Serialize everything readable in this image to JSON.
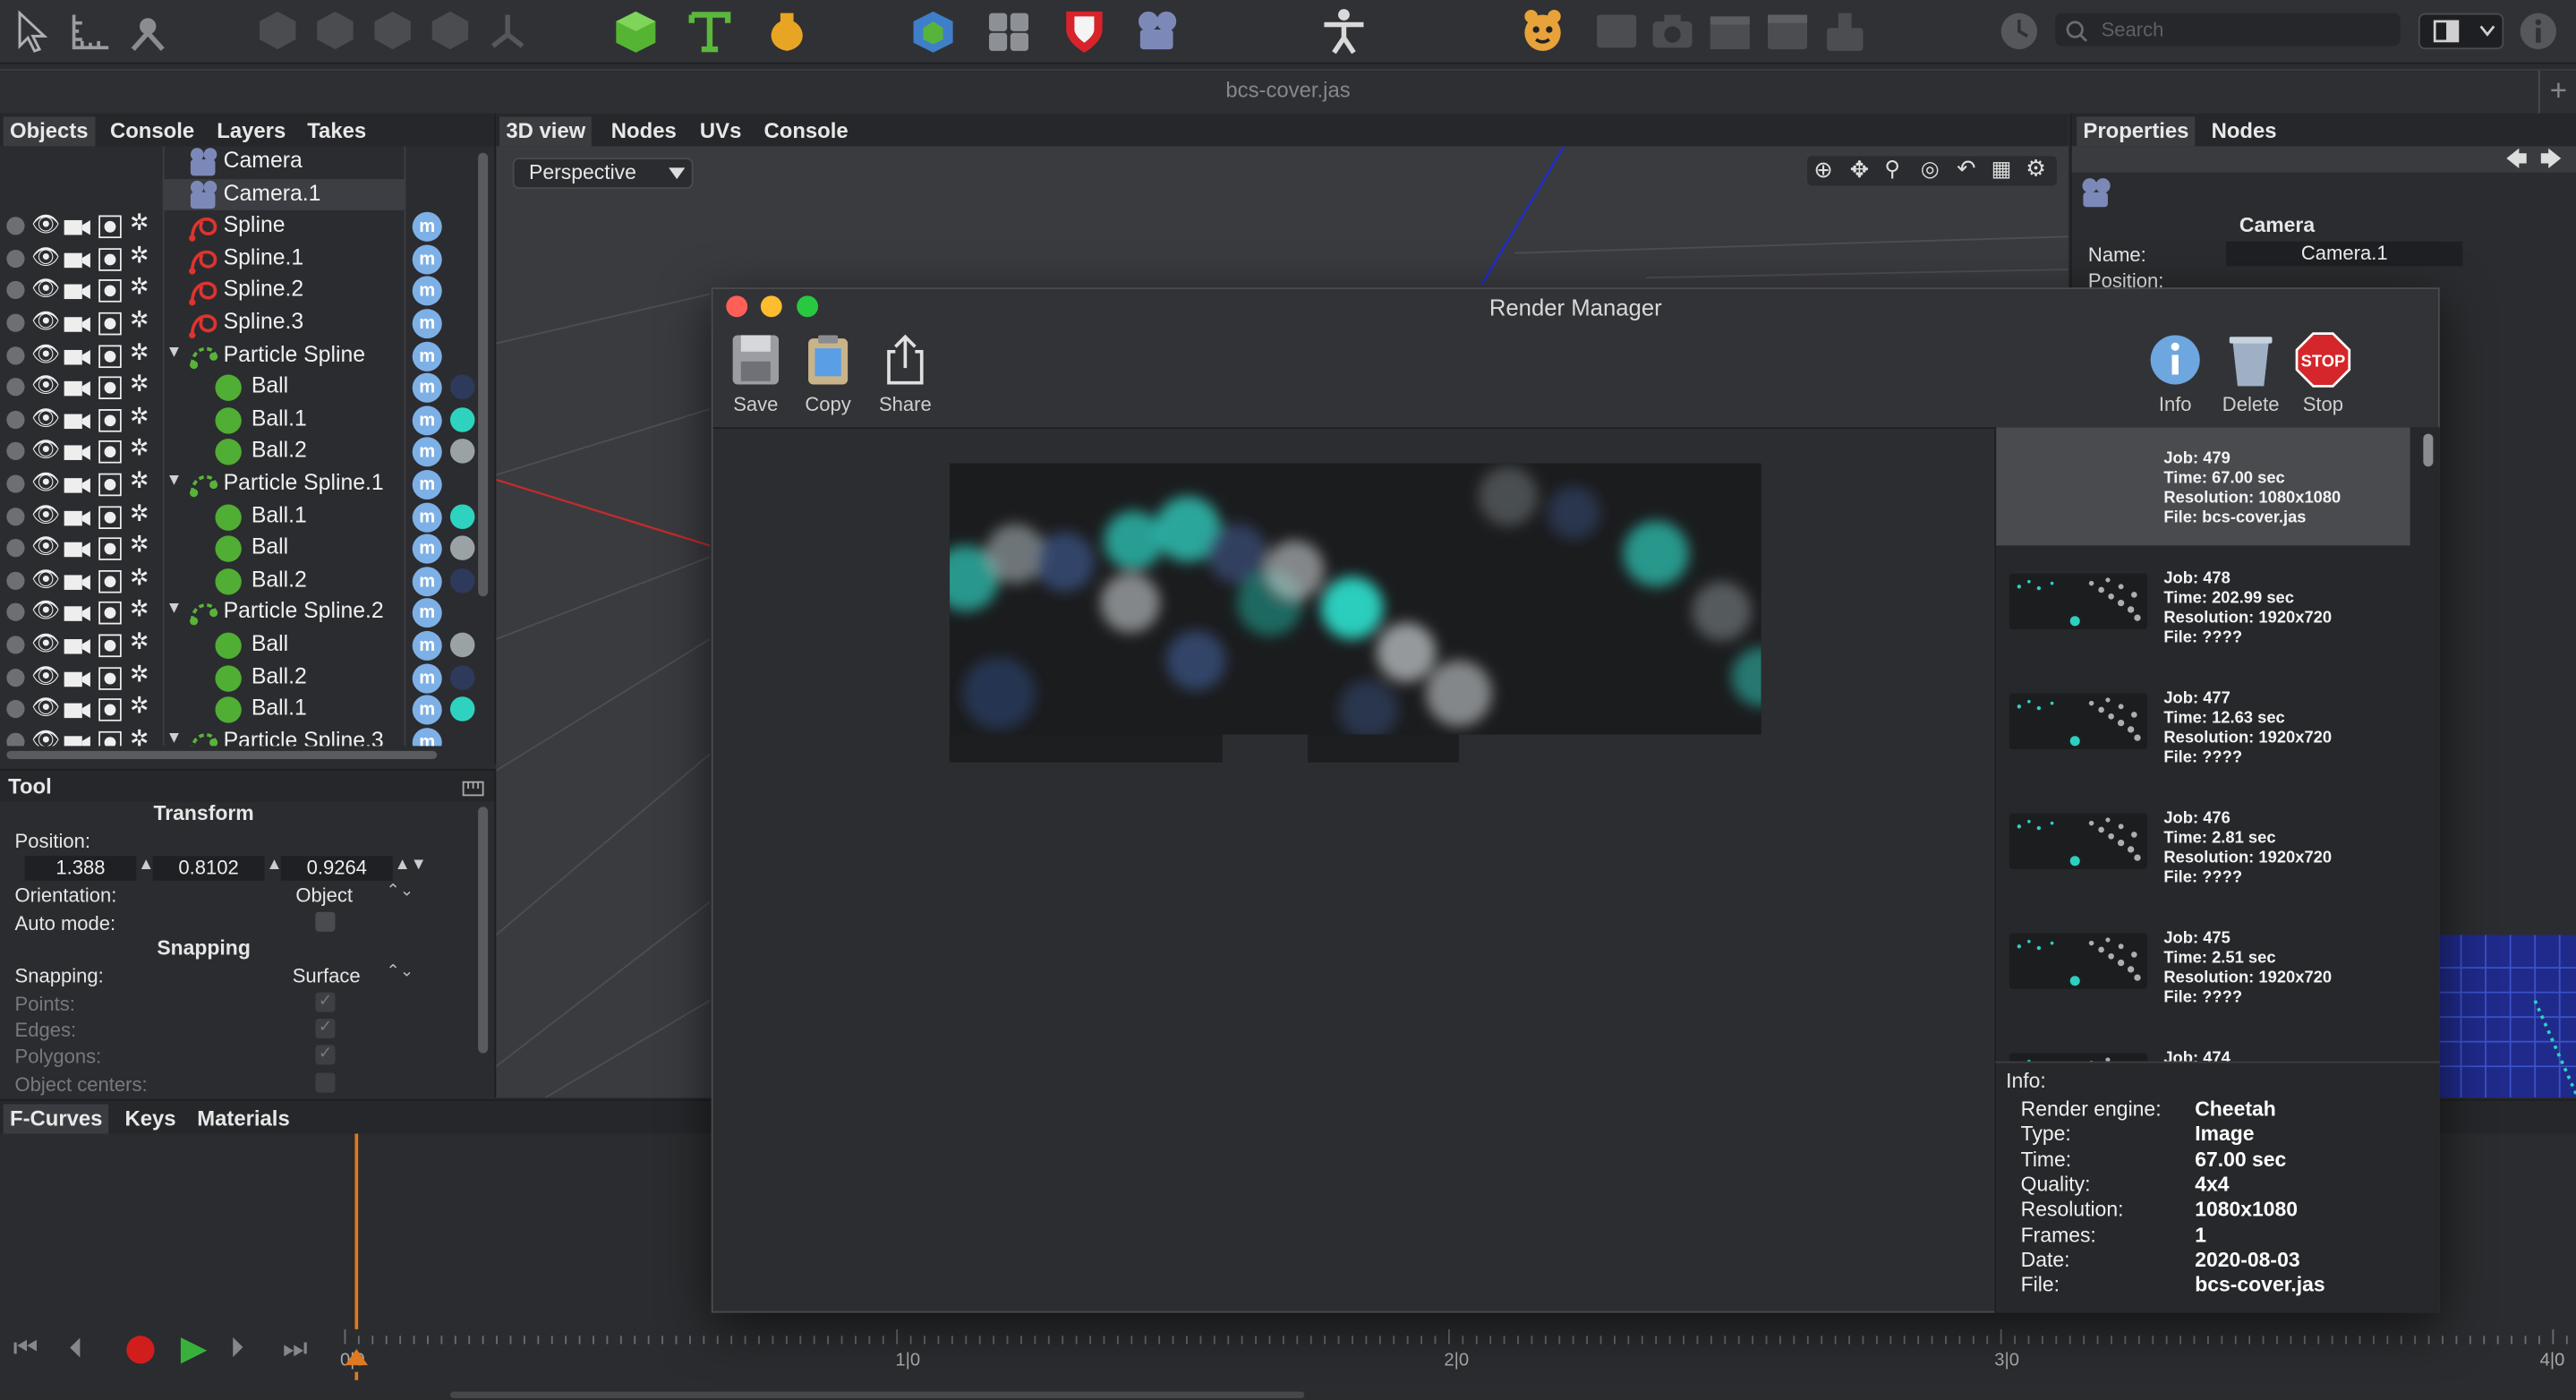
{
  "toolbar": {
    "search_placeholder": "Search"
  },
  "document_title": "bcs-cover.jas",
  "objects_panel": {
    "tabs": [
      "Objects",
      "Console",
      "Layers",
      "Takes"
    ],
    "items": [
      {
        "name": "Camera",
        "type": "camera",
        "indent": 0
      },
      {
        "name": "Camera.1",
        "type": "camera",
        "indent": 0,
        "selected": true
      },
      {
        "name": "Spline",
        "type": "spline",
        "indent": 0
      },
      {
        "name": "Spline.1",
        "type": "spline",
        "indent": 0
      },
      {
        "name": "Spline.2",
        "type": "spline",
        "indent": 0
      },
      {
        "name": "Spline.3",
        "type": "spline",
        "indent": 0
      },
      {
        "name": "Particle Spline",
        "type": "particle",
        "indent": 0,
        "expanded": true
      },
      {
        "name": "Ball",
        "type": "ball",
        "indent": 1,
        "swatch": "#2e3a5c"
      },
      {
        "name": "Ball.1",
        "type": "ball",
        "indent": 1,
        "swatch": "#2ed3c0"
      },
      {
        "name": "Ball.2",
        "type": "ball",
        "indent": 1,
        "swatch": "#9aa2a6"
      },
      {
        "name": "Particle Spline.1",
        "type": "particle",
        "indent": 0,
        "expanded": true
      },
      {
        "name": "Ball.1",
        "type": "ball",
        "indent": 1,
        "swatch": "#2ed3c0"
      },
      {
        "name": "Ball",
        "type": "ball",
        "indent": 1,
        "swatch": "#9aa2a6"
      },
      {
        "name": "Ball.2",
        "type": "ball",
        "indent": 1,
        "swatch": "#2e3a5c"
      },
      {
        "name": "Particle Spline.2",
        "type": "particle",
        "indent": 0,
        "expanded": true
      },
      {
        "name": "Ball",
        "type": "ball",
        "indent": 1,
        "swatch": "#9aa2a6"
      },
      {
        "name": "Ball.2",
        "type": "ball",
        "indent": 1,
        "swatch": "#2e3a5c"
      },
      {
        "name": "Ball.1",
        "type": "ball",
        "indent": 1,
        "swatch": "#2ed3c0"
      },
      {
        "name": "Particle Spline.3",
        "type": "particle",
        "indent": 0,
        "expanded": true
      }
    ]
  },
  "tool_panel": {
    "title": "Tool",
    "transform_heading": "Transform",
    "position_label": "Position:",
    "position": [
      "1.388",
      "0.8102",
      "0.9264"
    ],
    "orientation_label": "Orientation:",
    "orientation_value": "Object",
    "auto_mode_label": "Auto mode:",
    "snapping_heading": "Snapping",
    "snapping_label": "Snapping:",
    "snapping_value": "Surface",
    "points_label": "Points:",
    "edges_label": "Edges:",
    "polygons_label": "Polygons:",
    "object_centers_label": "Object centers:"
  },
  "viewport": {
    "tabs": [
      "3D view",
      "Nodes",
      "UVs",
      "Console"
    ],
    "projection": "Perspective"
  },
  "properties_panel": {
    "tabs": [
      "Properties",
      "Nodes"
    ],
    "heading": "Camera",
    "name_label": "Name:",
    "name_value": "Camera.1",
    "position_label": "Position:"
  },
  "render_manager": {
    "title": "Render Manager",
    "actions": {
      "save": "Save",
      "copy": "Copy",
      "share": "Share",
      "info": "Info",
      "delete": "Delete",
      "stop": "Stop"
    },
    "jobs": [
      {
        "job": "Job: 479",
        "time": "Time: 67.00 sec",
        "resolution": "Resolution: 1080x1080",
        "file": "File: bcs-cover.jas",
        "selected": true
      },
      {
        "job": "Job: 478",
        "time": "Time: 202.99 sec",
        "resolution": "Resolution: 1920x720",
        "file": "File: ????"
      },
      {
        "job": "Job: 477",
        "time": "Time: 12.63 sec",
        "resolution": "Resolution: 1920x720",
        "file": "File: ????"
      },
      {
        "job": "Job: 476",
        "time": "Time: 2.81 sec",
        "resolution": "Resolution: 1920x720",
        "file": "File: ????"
      },
      {
        "job": "Job: 475",
        "time": "Time: 2.51 sec",
        "resolution": "Resolution: 1920x720",
        "file": "File: ????"
      },
      {
        "job": "Job: 474",
        "time": "",
        "resolution": "",
        "file": ""
      }
    ],
    "info": {
      "heading": "Info:",
      "fields": [
        {
          "label": "Render engine:",
          "value": "Cheetah"
        },
        {
          "label": "Type:",
          "value": "Image"
        },
        {
          "label": "Time:",
          "value": "67.00 sec"
        },
        {
          "label": "Quality:",
          "value": "4x4"
        },
        {
          "label": "Resolution:",
          "value": "1080x1080"
        },
        {
          "label": "Frames:",
          "value": "1"
        },
        {
          "label": "Date:",
          "value": "2020-08-03"
        },
        {
          "label": "File:",
          "value": "bcs-cover.jas"
        }
      ]
    }
  },
  "timeline": {
    "tabs": [
      "F-Curves",
      "Keys",
      "Materials"
    ],
    "ticks": [
      "0|0",
      "1|0",
      "2|0",
      "3|0",
      "4|0"
    ],
    "current_frame": 0
  }
}
